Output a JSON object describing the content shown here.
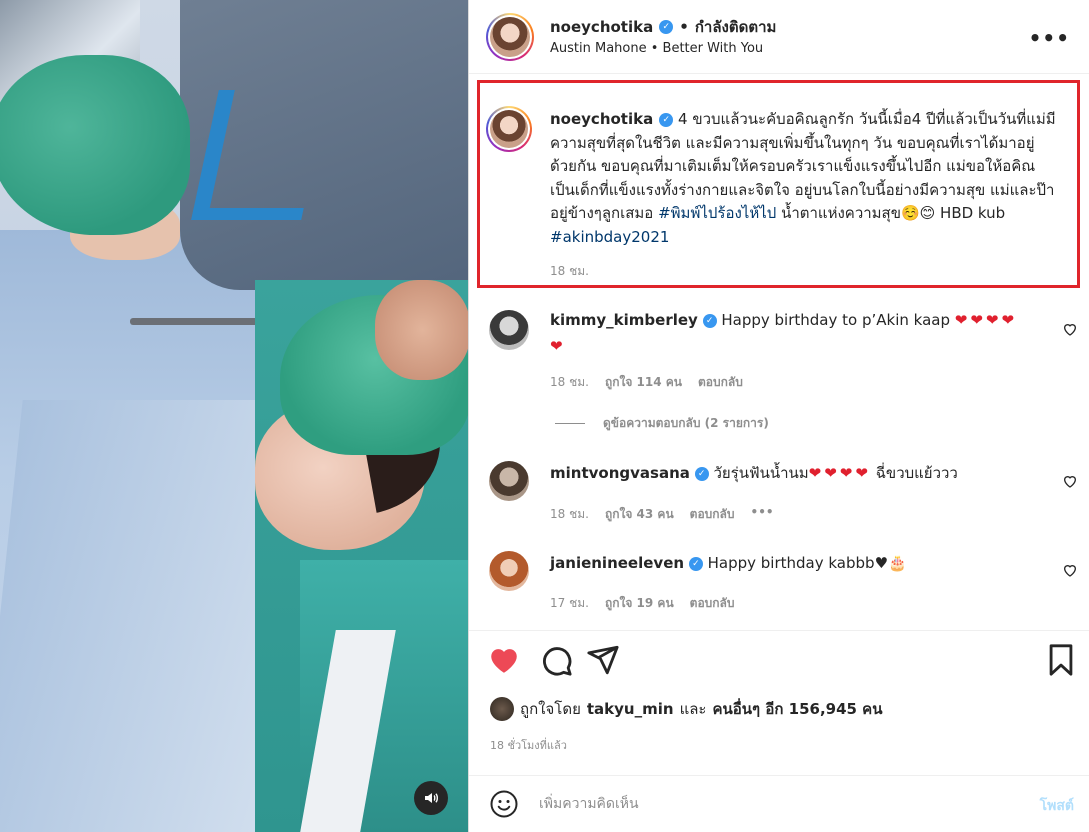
{
  "header": {
    "username": "noeychotika",
    "separator": "•",
    "follow_status": "กำลังติดตาม",
    "music": "Austin Mahone • Better With You",
    "more": "•••"
  },
  "caption": {
    "username": "noeychotika",
    "text_1": "4 ขวบแล้วนะคับอคิณลูกรัก วันนี้เมื่อ4 ปีที่แล้วเป็นวันที่แม่มีความสุขที่สุดในชีวิต และมีความสุขเพิ่มขึ้นในทุกๆ วัน ขอบคุณที่เราได้มาอยู่ด้วยกัน ขอบคุณที่มาเติมเต็มให้ครอบครัวเราแข็งแรงขึ้นไปอีก แม่ขอให้อคิณ เป็นเด็กที่แข็งแรงทั้งร่างกายและจิตใจ อยู่บนโลกใบนี้อย่างมีความสุข แม่และป๊าอยู่ข้างๆลูกเสมอ",
    "hashtag_1": "#พิมพ์ไปร้องไห้ไป",
    "text_2": "น้ำตาแห่งความสุข☺️😊 HBD kub",
    "hashtag_2": "#akinbday2021",
    "time": "18 ชม."
  },
  "comments": [
    {
      "username": "kimmy_kimberley",
      "text": "Happy birthday to p’Akin kaap",
      "hearts": "❤❤❤❤❤",
      "time": "18 ชม.",
      "likes": "ถูกใจ 114 คน",
      "reply": "ตอบกลับ"
    },
    {
      "username": "mintvongvasana",
      "text": "วัยรุ่นฟันน้ำนม",
      "hearts": "❤❤❤❤",
      "text_after": "ฉี่ขวบแย้ววว",
      "time": "18 ชม.",
      "likes": "ถูกใจ 43 คน",
      "reply": "ตอบกลับ",
      "more": "•••"
    },
    {
      "username": "janienineeleven",
      "text": "Happy birthday kabbb♥🎂",
      "time": "17 ชม.",
      "likes": "ถูกใจ 19 คน",
      "reply": "ตอบกลับ"
    }
  ],
  "view_replies": "ดูข้อความตอบกลับ (2 รายการ)",
  "likes": {
    "prefix": "ถูกใจโดย",
    "user": "takyu_min",
    "and": "และ",
    "others": "คนอื่นๆ อีก 156,945 คน"
  },
  "post_time": "18 ชั่วโมงที่แล้ว",
  "comment_input": {
    "placeholder": "เพิ่มความคิดเห็น",
    "post_label": "โพสต์"
  },
  "colors": {
    "like_red": "#ed4956",
    "verified_blue": "#3897f0",
    "highlight_border": "#e0252b",
    "hashtag": "#00376b"
  },
  "icons": [
    "heart-filled-icon",
    "comment-icon",
    "share-icon",
    "bookmark-icon",
    "emoji-icon",
    "speaker-icon",
    "verified-icon",
    "heart-outline-icon"
  ]
}
